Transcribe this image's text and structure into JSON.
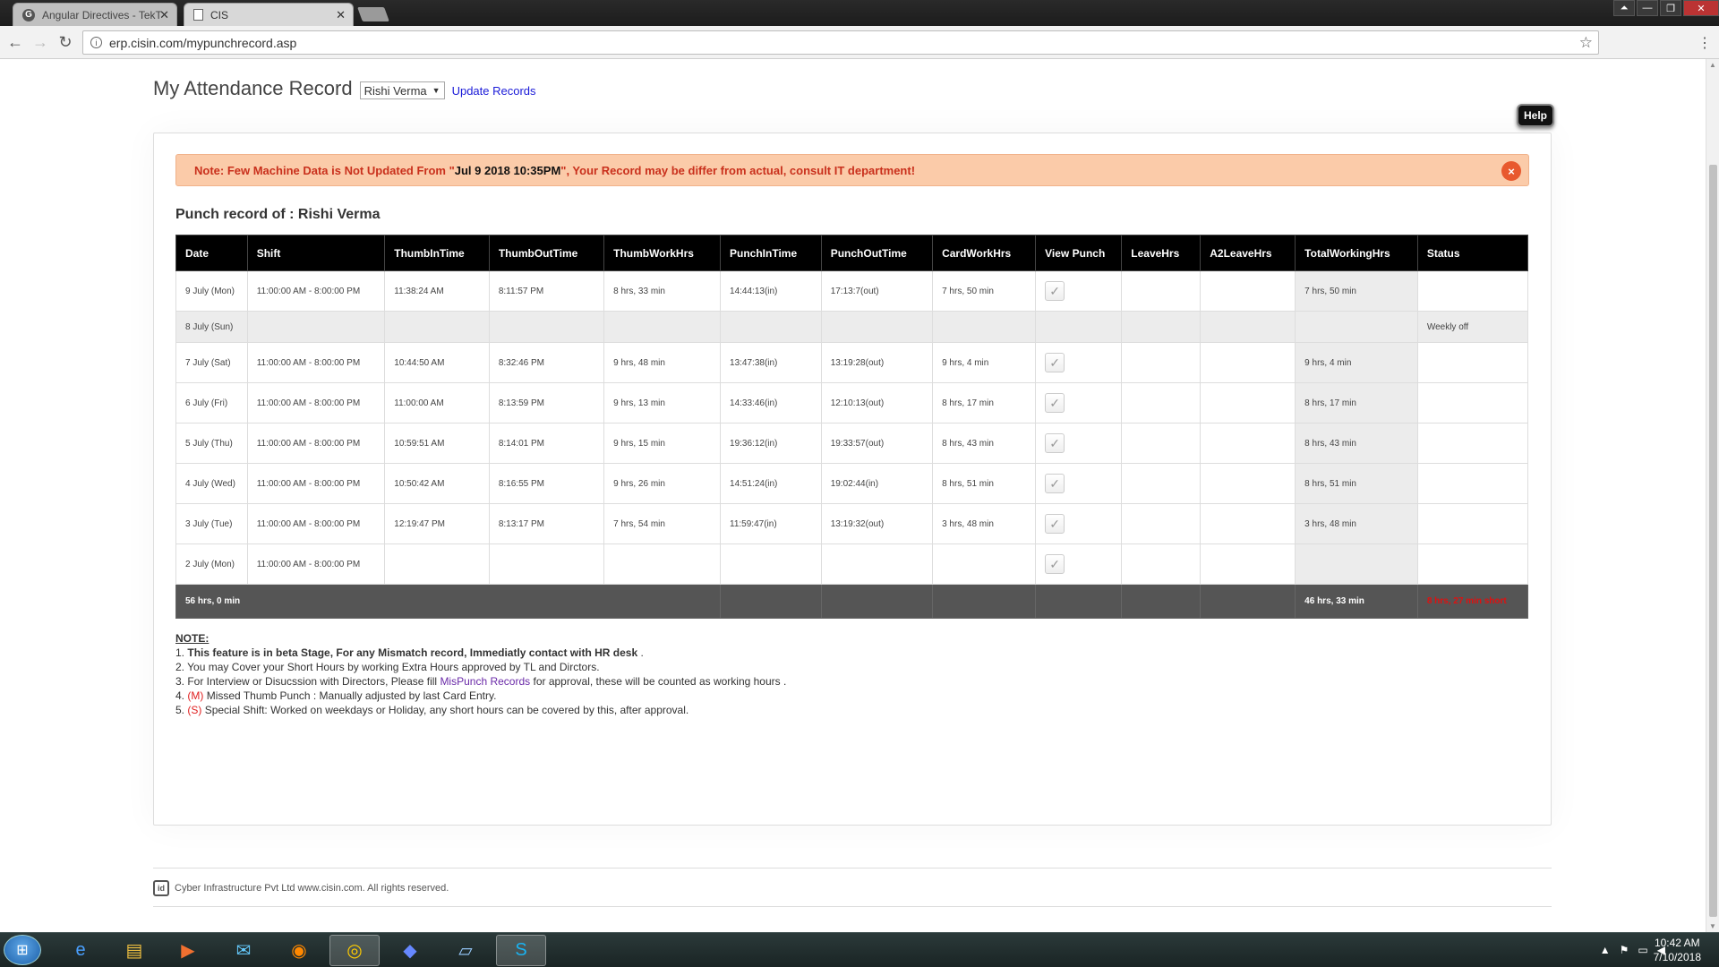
{
  "browser": {
    "tabs": [
      {
        "title": "Angular Directives - TekT",
        "favicon": "G",
        "active": false
      },
      {
        "title": "CIS",
        "active": true
      }
    ],
    "url": "erp.cisin.com/mypunchrecord.asp"
  },
  "header": {
    "title": "My Attendance Record",
    "employee_selected": "Rishi Verma",
    "update_link": "Update Records",
    "help": "Help"
  },
  "alert": {
    "prefix": "Note: Few Machine Data is Not Updated From \"",
    "datetime": "Jul 9 2018 10:35PM",
    "suffix": "\", Your Record may be differ from actual, consult IT department!",
    "close_icon": "×"
  },
  "record_title": "Punch record of : Rishi Verma",
  "table": {
    "columns": [
      "Date",
      "Shift",
      "ThumbInTime",
      "ThumbOutTime",
      "ThumbWorkHrs",
      "PunchInTime",
      "PunchOutTime",
      "CardWorkHrs",
      "View Punch",
      "LeaveHrs",
      "A2LeaveHrs",
      "TotalWorkingHrs",
      "Status"
    ],
    "rows": [
      {
        "date": "9 July (Mon)",
        "shift": "11:00:00 AM - 8:00:00 PM",
        "thumb_in": "11:38:24 AM",
        "thumb_out": "8:11:57 PM",
        "thumb_hrs": "8 hrs, 33 min",
        "punch_in": "14:44:13(in)",
        "punch_out": "17:13:7(out)",
        "card_hrs": "7 hrs, 50 min",
        "view": "✓",
        "leave": "",
        "a2leave": "",
        "total": "7 hrs, 50 min",
        "status": ""
      },
      {
        "date": "8 July (Sun)",
        "shift": "",
        "thumb_in": "",
        "thumb_out": "",
        "thumb_hrs": "",
        "punch_in": "",
        "punch_out": "",
        "card_hrs": "",
        "view": "",
        "leave": "",
        "a2leave": "",
        "total": "",
        "status": "Weekly off"
      },
      {
        "date": "7 July (Sat)",
        "shift": "11:00:00 AM - 8:00:00 PM",
        "thumb_in": "10:44:50 AM",
        "thumb_out": "8:32:46 PM",
        "thumb_hrs": "9 hrs, 48 min",
        "punch_in": "13:47:38(in)",
        "punch_out": "13:19:28(out)",
        "card_hrs": "9 hrs, 4 min",
        "view": "✓",
        "leave": "",
        "a2leave": "",
        "total": "9 hrs, 4 min",
        "status": ""
      },
      {
        "date": "6 July (Fri)",
        "shift": "11:00:00 AM - 8:00:00 PM",
        "thumb_in": "11:00:00 AM",
        "thumb_out": "8:13:59 PM",
        "thumb_hrs": "9 hrs, 13 min",
        "punch_in": "14:33:46(in)",
        "punch_out": "12:10:13(out)",
        "card_hrs": "8 hrs, 17 min",
        "view": "✓",
        "leave": "",
        "a2leave": "",
        "total": "8 hrs, 17 min",
        "status": ""
      },
      {
        "date": "5 July (Thu)",
        "shift": "11:00:00 AM - 8:00:00 PM",
        "thumb_in": "10:59:51 AM",
        "thumb_out": "8:14:01 PM",
        "thumb_hrs": "9 hrs, 15 min",
        "punch_in": "19:36:12(in)",
        "punch_out": "19:33:57(out)",
        "card_hrs": "8 hrs, 43 min",
        "view": "✓",
        "leave": "",
        "a2leave": "",
        "total": "8 hrs, 43 min",
        "status": ""
      },
      {
        "date": "4 July (Wed)",
        "shift": "11:00:00 AM - 8:00:00 PM",
        "thumb_in": "10:50:42 AM",
        "thumb_out": "8:16:55 PM",
        "thumb_hrs": "9 hrs, 26 min",
        "punch_in": "14:51:24(in)",
        "punch_out": "19:02:44(in)",
        "card_hrs": "8 hrs, 51 min",
        "view": "✓",
        "leave": "",
        "a2leave": "",
        "total": "8 hrs, 51 min",
        "status": ""
      },
      {
        "date": "3 July (Tue)",
        "shift": "11:00:00 AM - 8:00:00 PM",
        "thumb_in": "12:19:47 PM",
        "thumb_out": "8:13:17 PM",
        "thumb_hrs": "7 hrs, 54 min",
        "punch_in": "11:59:47(in)",
        "punch_out": "13:19:32(out)",
        "card_hrs": "3 hrs, 48 min",
        "view": "✓",
        "leave": "",
        "a2leave": "",
        "total": "3 hrs, 48 min",
        "status": ""
      },
      {
        "date": "2 July (Mon)",
        "shift": "11:00:00 AM - 8:00:00 PM",
        "thumb_in": "",
        "thumb_out": "",
        "thumb_hrs": "",
        "punch_in": "",
        "punch_out": "",
        "card_hrs": "",
        "view": "✓",
        "leave": "",
        "a2leave": "",
        "total": "",
        "status": ""
      }
    ],
    "totals": {
      "thumb_total": "56 hrs, 0 min",
      "total_working": "46 hrs, 33 min",
      "status": "8 hrs, 27 min short"
    }
  },
  "notes": {
    "heading": "NOTE:",
    "n1_num": "1.",
    "n1": "This feature is in beta Stage, For any Mismatch record, Immediatly contact with HR desk",
    "n2": "2. You may Cover your Short Hours by working Extra Hours approved by TL and Dirctors.",
    "n3_a": "3. For Interview or Disucssion with Directors, Please fill",
    "n3_link": "MisPunch Records",
    "n3_b": "for approval, these will be counted as working hours .",
    "n4_num": "4.",
    "n4_tag": "(M)",
    "n4": "Missed Thumb Punch : Manually adjusted by last Card Entry.",
    "n5_num": "5.",
    "n5_tag": "(S)",
    "n5": "Special Shift: Worked on weekdays or Holiday, any short hours can be covered by this, after approval."
  },
  "footer": {
    "logo": "id",
    "text": "Cyber Infrastructure Pvt Ltd www.cisin.com. All rights reserved."
  },
  "taskbar": {
    "apps": [
      "windows-start",
      "internet-explorer",
      "file-explorer",
      "media-player",
      "thunderbird",
      "firefox",
      "chrome",
      "visual-studio",
      "notes-app",
      "skype"
    ],
    "time": "10:42 AM",
    "date": "7/10/2018"
  }
}
